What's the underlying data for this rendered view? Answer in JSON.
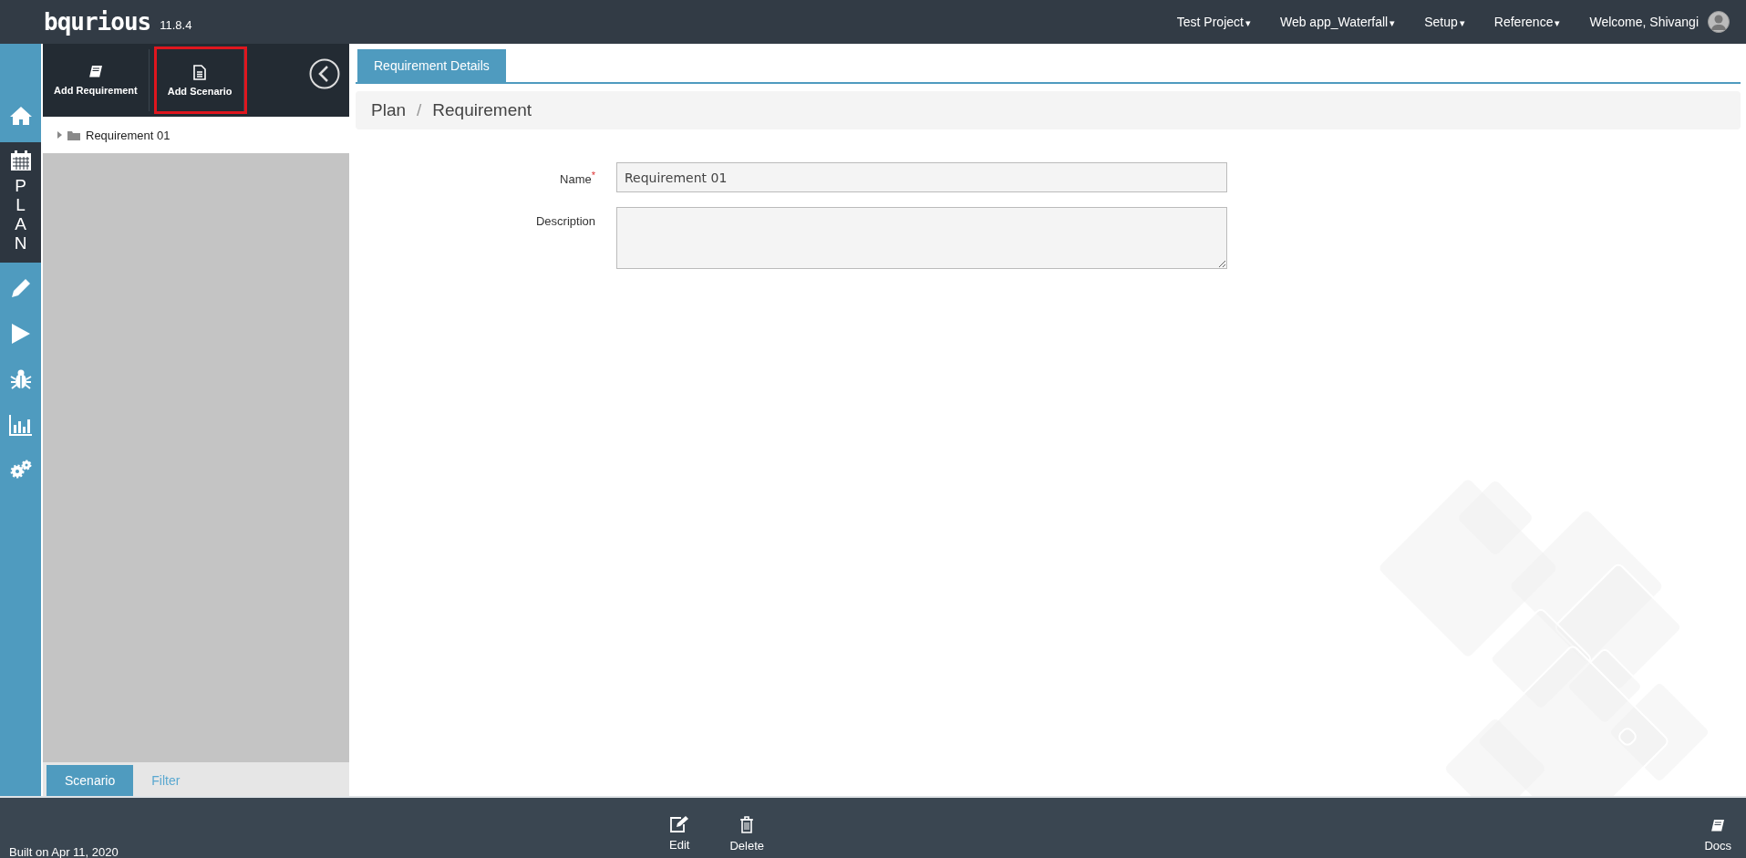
{
  "header": {
    "logo": "bqurious",
    "version": "11.8.4",
    "menus": [
      {
        "label": "Test Project",
        "caret": "▾"
      },
      {
        "label": "Web app_Waterfall",
        "caret": "▾"
      },
      {
        "label": "Setup",
        "caret": "▾"
      },
      {
        "label": "Reference",
        "caret": "▾"
      }
    ],
    "welcome": "Welcome, Shivangi"
  },
  "rail": {
    "items": [
      {
        "kind": "home",
        "selected": false
      },
      {
        "kind": "plan",
        "selected": true,
        "label": "PLAN"
      },
      {
        "kind": "pencil",
        "selected": false
      },
      {
        "kind": "play",
        "selected": false
      },
      {
        "kind": "bug",
        "selected": false
      },
      {
        "kind": "chart",
        "selected": false
      },
      {
        "kind": "gears",
        "selected": false
      }
    ]
  },
  "sidebar": {
    "actions": [
      {
        "kind": "book",
        "label": "Add Requirement",
        "highlighted": false
      },
      {
        "kind": "file",
        "label": "Add Scenario",
        "highlighted": true
      }
    ],
    "tree": [
      {
        "label": "Requirement 01",
        "expanded": false
      }
    ],
    "tabs": [
      {
        "label": "Scenario",
        "selected": true
      },
      {
        "label": "Filter",
        "selected": false
      }
    ]
  },
  "main": {
    "tabs": [
      {
        "label": "Requirement Details",
        "selected": true
      }
    ],
    "breadcrumb": [
      "Plan",
      "/",
      "Requirement"
    ],
    "form": [
      {
        "kind": "input",
        "label": "Name",
        "required": true,
        "required_mark": "*",
        "value": "Requirement 01"
      },
      {
        "kind": "textarea",
        "label": "Description",
        "required": false
      }
    ]
  },
  "footer": {
    "built": "Built on Apr 11, 2020",
    "actions": [
      {
        "kind": "edit",
        "label": "Edit"
      },
      {
        "kind": "delete",
        "label": "Delete"
      }
    ],
    "docs": "Docs"
  }
}
